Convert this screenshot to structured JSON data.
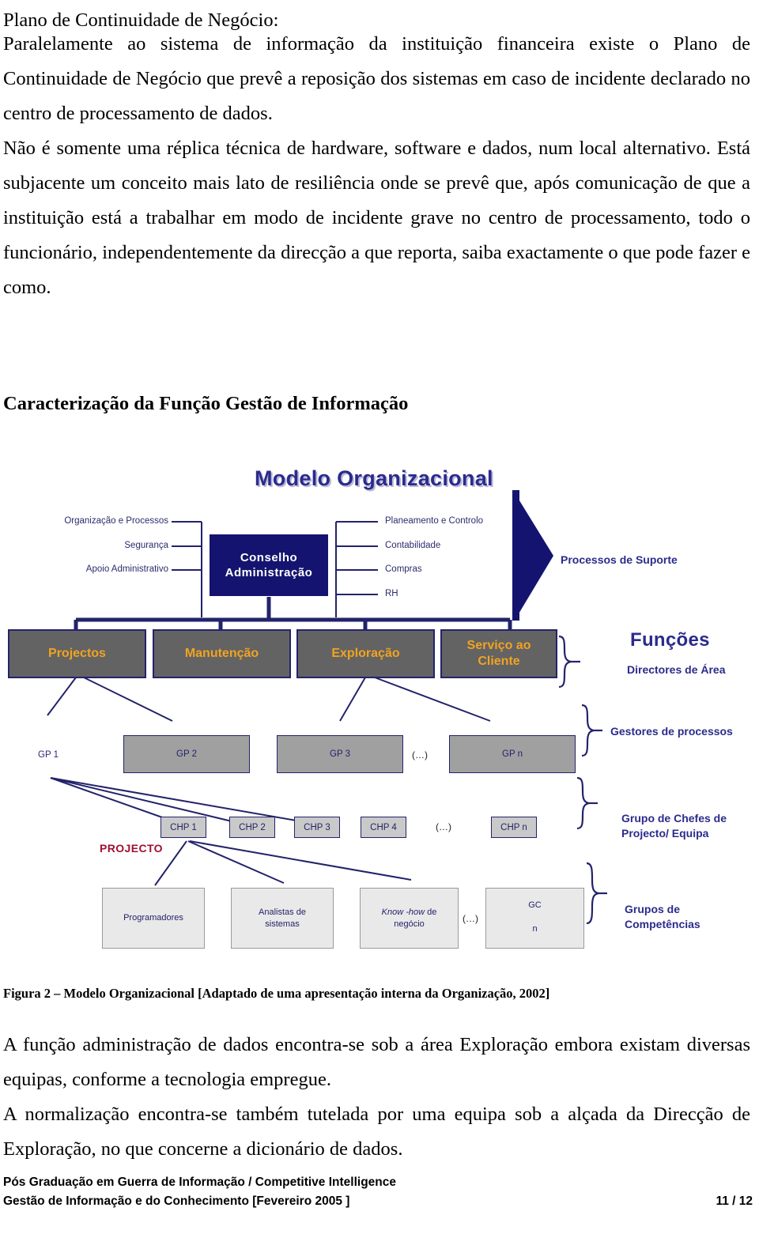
{
  "document": {
    "heading": "Plano de Continuidade de Negócio:",
    "paragraphs": [
      "Paralelamente ao sistema de informação da instituição financeira existe o Plano de Continuidade de Negócio que prevê a reposição dos sistemas em caso de incidente declarado no centro de processamento de dados.",
      "Não é somente uma réplica técnica de hardware, software e dados, num local alternativo. Está subjacente um conceito mais lato de resiliência onde se prevê que, após comunicação de que a instituição está a trabalhar em modo de incidente grave no centro de processamento, todo o funcionário, independentemente da direcção a que reporta, saiba exactamente o que pode fazer e como."
    ],
    "section_title": "Caracterização da Função Gestão de Informação",
    "figure_caption": "Figura 2 – Modelo Organizacional [Adaptado de uma apresentação interna da Organização, 2002]",
    "paragraphs_after": [
      "A função administração de dados encontra-se sob a área Exploração embora existam diversas equipas, conforme a tecnologia empregue.",
      "A normalização encontra-se também tutelada por uma equipa sob a alçada da Direcção de Exploração, no que concerne a dicionário de dados."
    ]
  },
  "figure": {
    "title": "Modelo Organizacional",
    "left_leaves": [
      "Organização e Processos",
      "Segurança",
      "Apoio Administrativo"
    ],
    "center_box": "Conselho Administração",
    "center_box_line1": "Conselho",
    "center_box_line2": "Administração",
    "right_leaves": [
      "Planeamento e Controlo",
      "Contabilidade",
      "Compras",
      "RH"
    ],
    "support_label": "Processos de Suporte",
    "functions_label": "Funções",
    "area_directors_label": "Directores de Área",
    "function_boxes": [
      "Projectos",
      "Manutenção",
      "Exploração",
      "Serviço ao Cliente"
    ],
    "function_box_4_line1": "Serviço ao",
    "function_box_4_line2": "Cliente",
    "gp_label_standalone": "GP 1",
    "gp_boxes": [
      "GP 2",
      "GP 3",
      "GP n"
    ],
    "gp_ellipsis": "(…)",
    "gp_group_label": "Gestores de processos",
    "chp_boxes": [
      "CHP 1",
      "CHP 2",
      "CHP 3",
      "CHP 4",
      "CHP n"
    ],
    "chp_ellipsis": "(…)",
    "chp_group_label_line1": "Grupo de Chefes de",
    "chp_group_label_line2": "Projecto/ Equipa",
    "projecto_label": "PROJECTO",
    "competency_boxes": [
      {
        "line1": "Programadores",
        "line2": "",
        "italic_prefix": ""
      },
      {
        "line1": "Analistas de",
        "line2": "sistemas",
        "italic_prefix": ""
      },
      {
        "line1": "negócio",
        "line2": "",
        "italic_prefix": "Know -how",
        "plain_suffix": " de"
      },
      {
        "line1": "GC",
        "line2": "n",
        "italic_prefix": ""
      }
    ],
    "competency_ellipsis": "(…)",
    "competency_group_label_line1": "Grupos de",
    "competency_group_label_line2": "Competências",
    "colors": {
      "navy": "#141470",
      "title_blue": "#2b2b8c",
      "gray_box": "#636363",
      "orange_text": "#f0a321",
      "red_text": "#a01030",
      "gp_gray": "#a0a0a0",
      "chp_gray": "#c9c9c9",
      "gc_gray": "#e9e9e9"
    }
  },
  "footer": {
    "line1": "Pós Graduação em Guerra de Informação / Competitive Intelligence",
    "line2": "Gestão de Informação e do Conhecimento [Fevereiro 2005 ]",
    "page": "11 / 12"
  }
}
